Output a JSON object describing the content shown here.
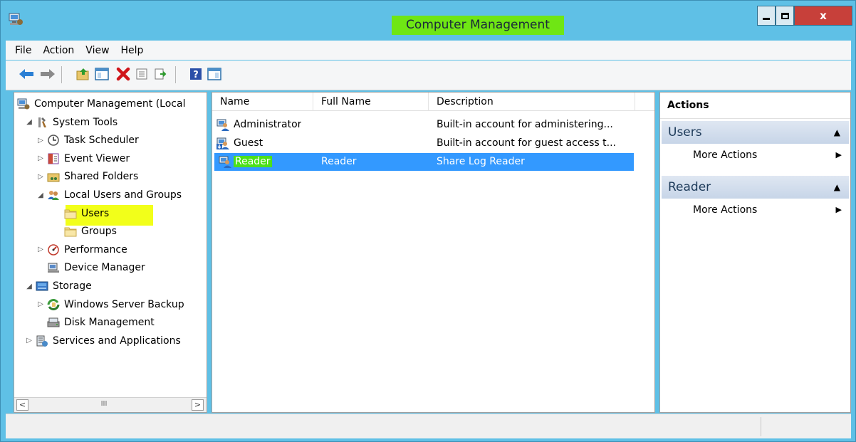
{
  "window": {
    "title": "Computer Management",
    "buttons": {
      "minimize": "minimize",
      "maximize": "maximize",
      "close": "x"
    }
  },
  "menu": [
    "File",
    "Action",
    "View",
    "Help"
  ],
  "toolbar": [
    "back-arrow-icon",
    "forward-arrow-icon",
    "up-folder-icon",
    "show-hide-tree-icon",
    "delete-icon",
    "properties-icon",
    "export-list-icon",
    "help-icon",
    "show-action-pane-icon"
  ],
  "tree": {
    "items": [
      {
        "label": "Computer Management (Local",
        "icon": "computer-management-icon",
        "level": 0,
        "toggle": ""
      },
      {
        "label": "System Tools",
        "icon": "system-tools-icon",
        "level": 1,
        "toggle": "◢"
      },
      {
        "label": "Task Scheduler",
        "icon": "clock-icon",
        "level": 2,
        "toggle": "▷"
      },
      {
        "label": "Event Viewer",
        "icon": "event-viewer-icon",
        "level": 2,
        "toggle": "▷"
      },
      {
        "label": "Shared Folders",
        "icon": "shared-folder-icon",
        "level": 2,
        "toggle": "▷"
      },
      {
        "label": "Local Users and Groups",
        "icon": "users-group-icon",
        "level": 2,
        "toggle": "◢"
      },
      {
        "label": "Users",
        "icon": "folder-icon",
        "level": 3,
        "toggle": ""
      },
      {
        "label": "Groups",
        "icon": "folder-icon",
        "level": 3,
        "toggle": ""
      },
      {
        "label": "Performance",
        "icon": "performance-icon",
        "level": 2,
        "toggle": "▷"
      },
      {
        "label": "Device Manager",
        "icon": "device-manager-icon",
        "level": 2,
        "toggle": ""
      },
      {
        "label": "Storage",
        "icon": "storage-icon",
        "level": 1,
        "toggle": "◢"
      },
      {
        "label": "Windows Server Backup",
        "icon": "backup-icon",
        "level": 2,
        "toggle": "▷"
      },
      {
        "label": "Disk Management",
        "icon": "disk-icon",
        "level": 2,
        "toggle": ""
      },
      {
        "label": "Services and Applications",
        "icon": "services-icon",
        "level": 1,
        "toggle": "▷"
      }
    ],
    "scroll": {
      "left": "<",
      "thumb": "III",
      "right": ">"
    }
  },
  "list": {
    "columns": [
      "Name",
      "Full Name",
      "Description"
    ],
    "rows": [
      {
        "name": "Administrator",
        "full_name": "",
        "description": "Built-in account for administering...",
        "selected": false
      },
      {
        "name": "Guest",
        "full_name": "",
        "description": "Built-in account for guest access t...",
        "selected": false
      },
      {
        "name": "Reader",
        "full_name": "Reader",
        "description": "Share Log Reader",
        "selected": true
      }
    ]
  },
  "actions": {
    "title": "Actions",
    "sections": [
      {
        "header": "Users",
        "items": [
          "More Actions"
        ]
      },
      {
        "header": "Reader",
        "items": [
          "More Actions"
        ]
      }
    ]
  },
  "colors": {
    "titlebar": "#5fc0e6",
    "title_highlight": "#6fe614",
    "users_highlight": "#f2ff1a",
    "selection": "#3399ff",
    "reader_highlight": "#4ce01a",
    "close_button": "#c7403a"
  }
}
